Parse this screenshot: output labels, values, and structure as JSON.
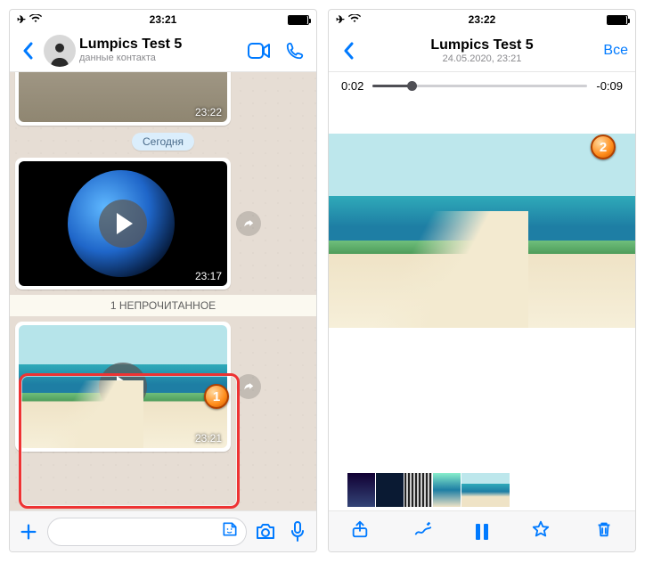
{
  "status": {
    "time": "23:21",
    "time2": "23:22"
  },
  "chat": {
    "title": "Lumpics Test 5",
    "subtitle": "данные контакта",
    "date_chip": "Сегодня",
    "unread_label": "1 НЕПРОЧИТАННОЕ",
    "msg_rock_ts": "23:22",
    "msg_earth_ts": "23:17",
    "msg_beach_ts": "23:21"
  },
  "viewer": {
    "title": "Lumpics Test 5",
    "subtitle": "24.05.2020, 23:21",
    "all_label": "Все",
    "elapsed": "0:02",
    "remaining": "-0:09"
  },
  "callouts": {
    "one": "1",
    "two": "2"
  }
}
